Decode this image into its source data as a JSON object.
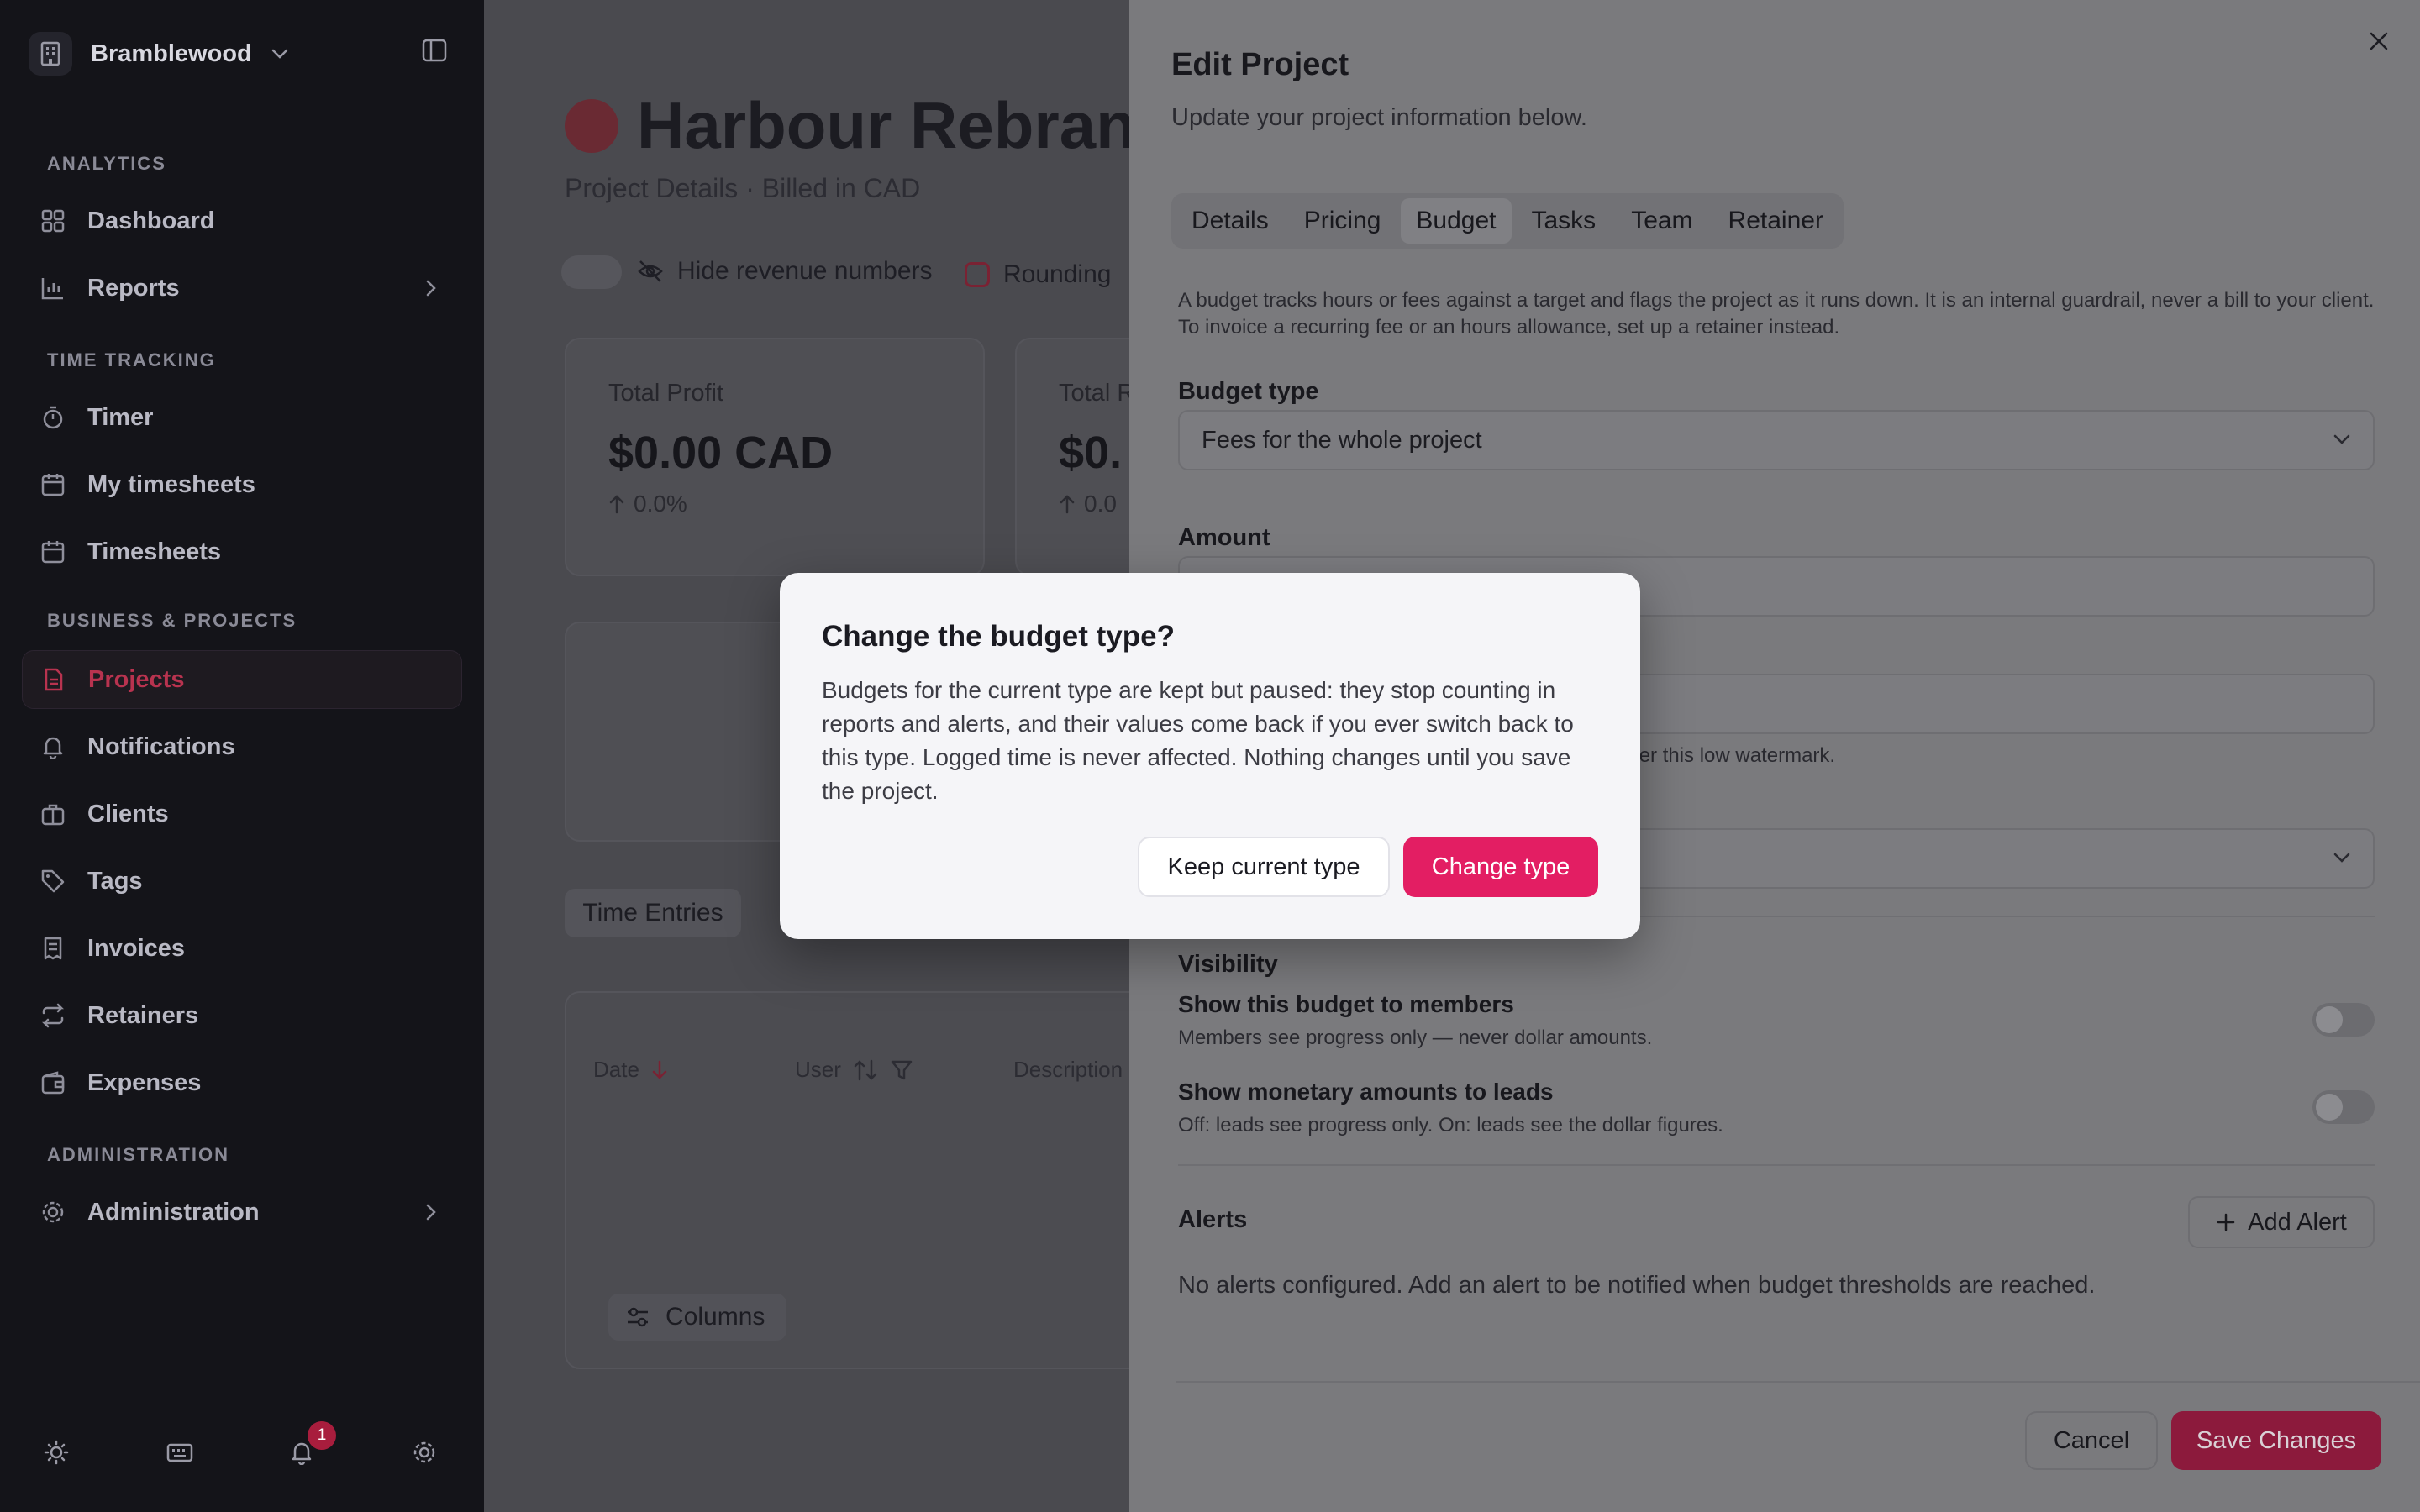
{
  "workspace": {
    "name": "Bramblewood"
  },
  "sidebar": {
    "sections": {
      "analytics": "ANALYTICS",
      "time_tracking": "TIME TRACKING",
      "business": "BUSINESS & PROJECTS",
      "administration": "ADMINISTRATION"
    },
    "items": {
      "dashboard": "Dashboard",
      "reports": "Reports",
      "timer": "Timer",
      "my_timesheets": "My timesheets",
      "timesheets": "Timesheets",
      "projects": "Projects",
      "notifications": "Notifications",
      "clients": "Clients",
      "tags": "Tags",
      "invoices": "Invoices",
      "retainers": "Retainers",
      "expenses": "Expenses",
      "administration": "Administration"
    },
    "active_item": "projects",
    "notification_badge": "1",
    "accent_color": "#b8334f"
  },
  "project": {
    "title": "Harbour Rebrand",
    "subtitle": "Project Details · Billed in CAD",
    "hide_revenue_label": "Hide revenue numbers",
    "rounding_label": "Rounding",
    "cards": [
      {
        "label": "Total Profit",
        "value": "$0.00 CAD",
        "change": "0.0%"
      },
      {
        "label": "Total R",
        "value": "$0.",
        "change": "0.0"
      }
    ],
    "tab_time_entries": "Time Entries",
    "table_headers": {
      "date": "Date",
      "user": "User",
      "description": "Description"
    },
    "columns_button": "Columns"
  },
  "edit_panel": {
    "title": "Edit Project",
    "subtitle": "Update your project information below.",
    "tabs": [
      "Details",
      "Pricing",
      "Budget",
      "Tasks",
      "Team",
      "Retainer"
    ],
    "active_tab": "Budget",
    "description": "A budget tracks hours or fees against a target and flags the project as it runs down. It is an internal guardrail, never a bill to your client. To invoice a recurring fee or an hours allowance, set up a retainer instead.",
    "budget_type_label": "Budget type",
    "budget_type_value": "Fees for the whole project",
    "amount_label": "Amount",
    "watermark_hint": "nder this low watermark.",
    "visibility_title": "Visibility",
    "show_members_title": "Show this budget to members",
    "show_members_sub": "Members see progress only — never dollar amounts.",
    "show_leads_title": "Show monetary amounts to leads",
    "show_leads_sub": "Off: leads see progress only. On: leads see the dollar figures.",
    "alerts_title": "Alerts",
    "add_alert_label": "Add Alert",
    "no_alerts": "No alerts configured. Add an alert to be notified when budget thresholds are reached.",
    "cancel_label": "Cancel",
    "save_label": "Save Changes"
  },
  "modal": {
    "title": "Change the budget type?",
    "body": "Budgets for the current type are kept but paused: they stop counting in reports and alerts, and their values come back if you ever switch back to this type. Logged time is never affected. Nothing changes until you save the project.",
    "keep_label": "Keep current type",
    "change_label": "Change type",
    "primary_color": "#e31e63"
  }
}
